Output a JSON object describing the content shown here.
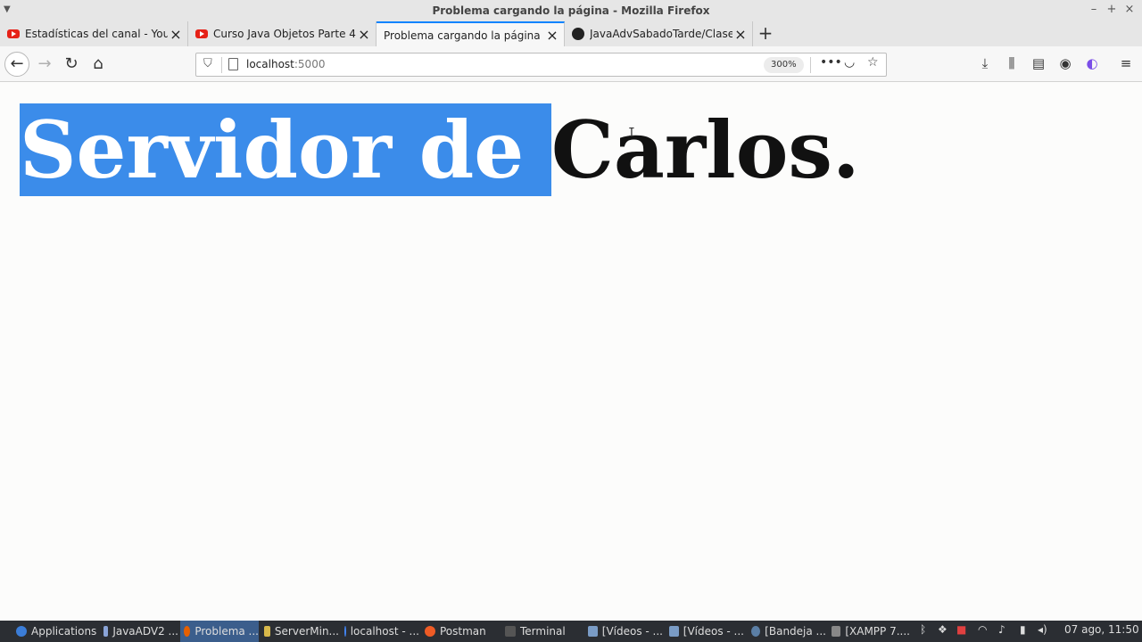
{
  "window": {
    "title": "Problema cargando la página - Mozilla Firefox",
    "controls": [
      "–",
      "+",
      "×"
    ]
  },
  "tabs": [
    {
      "label": "Estadísticas del canal - YouTu",
      "icon": "youtube-icon",
      "active": false
    },
    {
      "label": "Curso Java Objetos Parte 4 - Y",
      "icon": "youtube-icon",
      "active": false
    },
    {
      "label": "Problema cargando la página",
      "icon": "none",
      "active": true
    },
    {
      "label": "JavaAdvSabadoTarde/Clase03",
      "icon": "github-icon",
      "active": false
    }
  ],
  "nav": {
    "url_host": "localhost",
    "url_port": ":5000",
    "zoom": "300%"
  },
  "page": {
    "heading_selected": "Servidor de ",
    "heading_rest": "Carlos."
  },
  "taskbar": {
    "start_label": "Applications",
    "items": [
      {
        "label": "JavaADV2 ...",
        "color": "#8aa4d8"
      },
      {
        "label": "Problema ...",
        "color": "#e66000",
        "active": true
      },
      {
        "label": "ServerMin...",
        "color": "#d8b84a"
      },
      {
        "label": "localhost - ...",
        "color": "#4285f4"
      },
      {
        "label": "Postman",
        "color": "#ef5b25"
      },
      {
        "label": "Terminal",
        "color": "#555555"
      },
      {
        "label": "[Vídeos - ...",
        "color": "#7a9cc6"
      },
      {
        "label": "[Vídeos - ...",
        "color": "#7a9cc6"
      },
      {
        "label": "[Bandeja ...",
        "color": "#5b7fa6"
      },
      {
        "label": "[XAMPP 7....",
        "color": "#888888"
      }
    ],
    "clock": "07 ago, 11:50"
  },
  "colors": {
    "selection": "#3b8cea",
    "active_tab_accent": "#0a84ff",
    "taskbar_bg": "#2b2e33"
  }
}
